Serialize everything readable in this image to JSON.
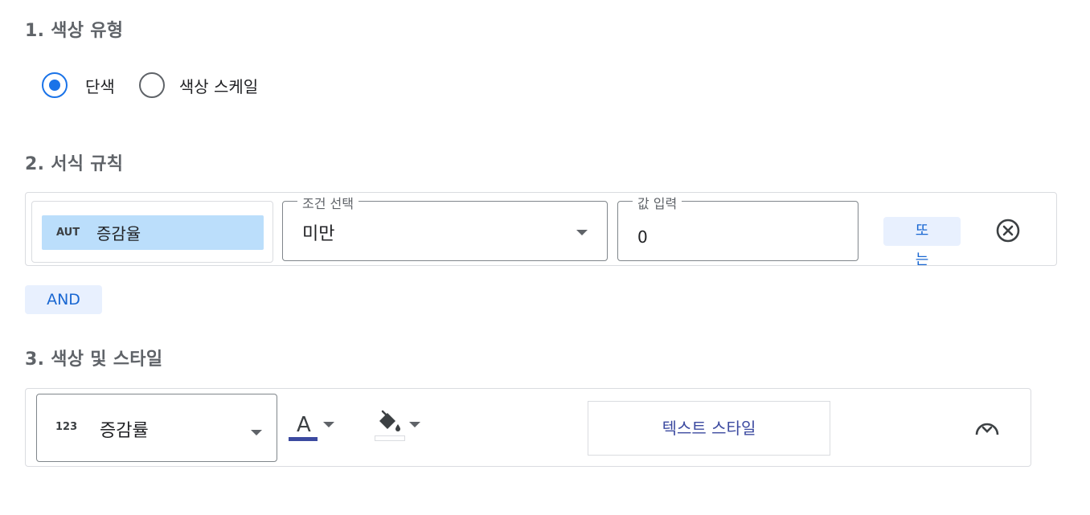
{
  "section1": {
    "title": "1. 색상 유형",
    "options": [
      {
        "label": "단색",
        "checked": true
      },
      {
        "label": "색상 스케일",
        "checked": false
      }
    ]
  },
  "section2": {
    "title": "2. 서식 규칙",
    "rule": {
      "field_type": "AUT",
      "field_name": "증감율",
      "condition_legend": "조건 선택",
      "condition_value": "미만",
      "value_legend": "값 입력",
      "value": "0",
      "or_label_line1": "또",
      "or_label_line2": "는",
      "remove_icon": "close-circle-icon"
    },
    "and_label": "AND"
  },
  "section3": {
    "title": "3. 색상 및 스타일",
    "field_type": "123",
    "field_name": "증감률",
    "text_color_glyph": "A",
    "text_color": "#3c4aa0",
    "fill_color": "#ffffff",
    "text_style_label": "텍스트 스타일"
  },
  "colors": {
    "accent": "#1a73e8",
    "chip_bg": "#bbdefb",
    "button_bg": "#e8f0fe",
    "button_text": "#1967d2"
  }
}
